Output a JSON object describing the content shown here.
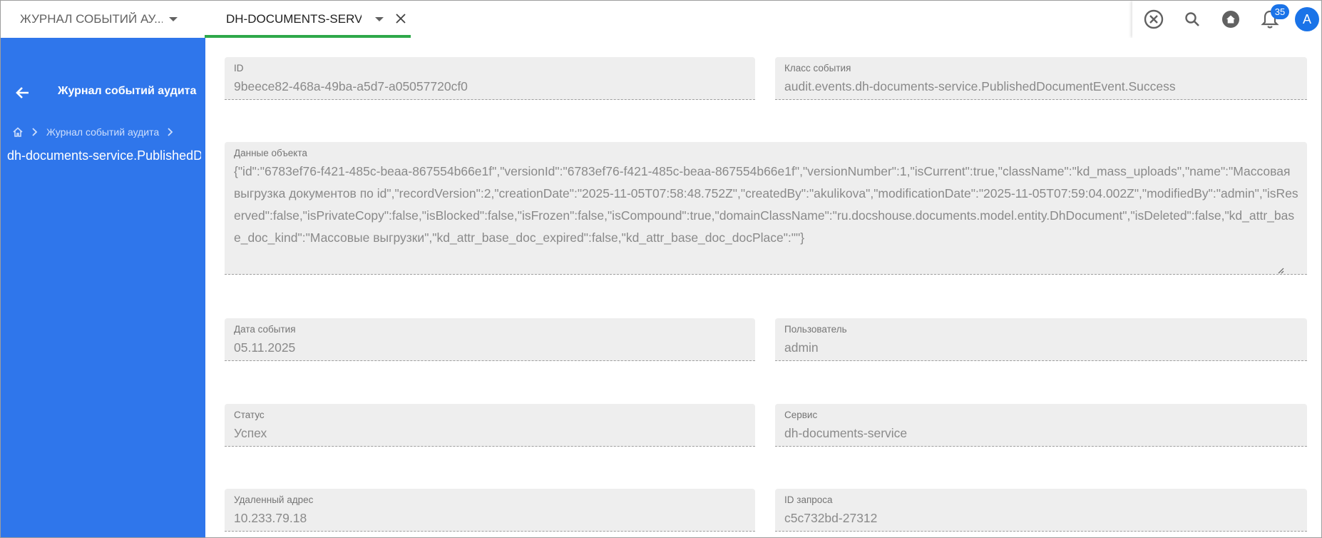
{
  "tabs": [
    {
      "label": "ЖУРНАЛ СОБЫТИЙ АУ..."
    },
    {
      "label": "DH-DOCUMENTS-SERVI..."
    }
  ],
  "header": {
    "notifications_count": "35",
    "avatar_letter": "A"
  },
  "sidebar": {
    "title": "Журнал событий аудита",
    "breadcrumb": {
      "parent": "Журнал событий аудита"
    },
    "current": "dh-documents-service.PublishedDocumentEvent.Success"
  },
  "fields": {
    "id": {
      "label": "ID",
      "value": "9beece82-468a-49ba-a5d7-a05057720cf0"
    },
    "event_class": {
      "label": "Класс события",
      "value": "audit.events.dh-documents-service.PublishedDocumentEvent.Success"
    },
    "object_data": {
      "label": "Данные объекта",
      "value": "{\"id\":\"6783ef76-f421-485c-beaa-867554b66e1f\",\"versionId\":\"6783ef76-f421-485c-beaa-867554b66e1f\",\"versionNumber\":1,\"isCurrent\":true,\"className\":\"kd_mass_uploads\",\"name\":\"Массовая выгрузка документов по id\",\"recordVersion\":2,\"creationDate\":\"2025-11-05T07:58:48.752Z\",\"createdBy\":\"akulikova\",\"modificationDate\":\"2025-11-05T07:59:04.002Z\",\"modifiedBy\":\"admin\",\"isReserved\":false,\"isPrivateCopy\":false,\"isBlocked\":false,\"isFrozen\":false,\"isCompound\":true,\"domainClassName\":\"ru.docshouse.documents.model.entity.DhDocument\",\"isDeleted\":false,\"kd_attr_base_doc_kind\":\"Массовые выгрузки\",\"kd_attr_base_doc_expired\":false,\"kd_attr_base_doc_docPlace\":\"\"}"
    },
    "event_date": {
      "label": "Дата события",
      "value": "05.11.2025"
    },
    "user": {
      "label": "Пользователь",
      "value": "admin"
    },
    "status": {
      "label": "Статус",
      "value": "Успех"
    },
    "service": {
      "label": "Сервис",
      "value": "dh-documents-service"
    },
    "remote_address": {
      "label": "Удаленный адрес",
      "value": "10.233.79.18"
    },
    "request_id": {
      "label": "ID запроса",
      "value": "c5c732bd-27312"
    }
  },
  "colors": {
    "sidebar": "#2f76eb",
    "active_tab_underline": "#2ea84a",
    "accent": "#1a73e8"
  }
}
